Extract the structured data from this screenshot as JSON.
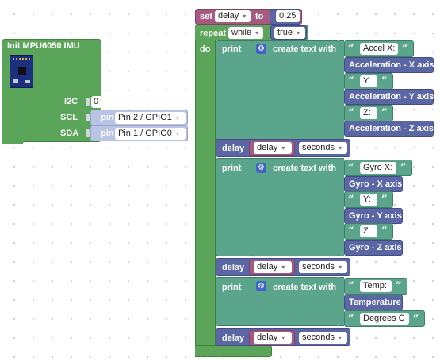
{
  "init_block": {
    "title": "Init MPU6050 IMU",
    "i2c_label": "I2C",
    "i2c_value": "0",
    "scl_label": "SCL",
    "sda_label": "SDA",
    "pin_label": "pin",
    "scl_pin": "Pin 2 / GPIO1",
    "sda_pin": "Pin 1 / GPIO0",
    "board_image": "imu-board-icon"
  },
  "set_block": {
    "set_label": "set",
    "variable": "delay",
    "to_label": "to",
    "value": "0.25"
  },
  "repeat_block": {
    "repeat_label": "repeat",
    "mode": "while",
    "condition": "true",
    "do_label": "do"
  },
  "print_blocks": [
    {
      "print_label": "print",
      "create_label": "create text with",
      "items": [
        {
          "kind": "text",
          "value": "Accel X:"
        },
        {
          "kind": "value",
          "value": "Acceleration - X axis"
        },
        {
          "kind": "text",
          "value": "Y:"
        },
        {
          "kind": "value",
          "value": "Acceleration - Y axis"
        },
        {
          "kind": "text",
          "value": "Z:"
        },
        {
          "kind": "value",
          "value": "Acceleration - Z axis"
        }
      ]
    },
    {
      "print_label": "print",
      "create_label": "create text with",
      "items": [
        {
          "kind": "text",
          "value": "Gyro X:"
        },
        {
          "kind": "value",
          "value": "Gyro - X axis"
        },
        {
          "kind": "text",
          "value": "Y:"
        },
        {
          "kind": "value",
          "value": "Gyro - Y axis"
        },
        {
          "kind": "text",
          "value": "Z:"
        },
        {
          "kind": "value",
          "value": "Gyro - Z axis"
        }
      ]
    },
    {
      "print_label": "print",
      "create_label": "create text with",
      "items": [
        {
          "kind": "text",
          "value": "Temp:"
        },
        {
          "kind": "value",
          "value": "Temperature"
        },
        {
          "kind": "text",
          "value": "Degrees C"
        }
      ]
    }
  ],
  "delay_blocks": [
    {
      "label": "delay",
      "variable": "delay",
      "unit": "seconds"
    },
    {
      "label": "delay",
      "variable": "delay",
      "unit": "seconds"
    },
    {
      "label": "delay",
      "variable": "delay",
      "unit": "seconds"
    }
  ],
  "colors": {
    "loop_green": "#5ba55b",
    "init_green": "#5ba55b",
    "variable_purple": "#a55b80",
    "text_teal": "#5ba58c",
    "io_blue": "#5b67a5",
    "gear_blue": "#3f63c7"
  }
}
